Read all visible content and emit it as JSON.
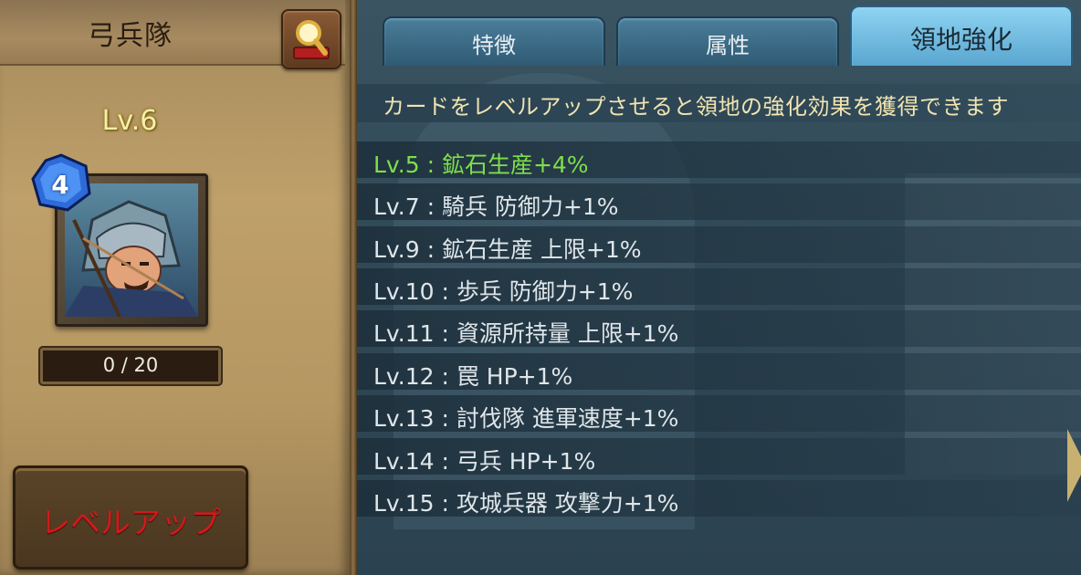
{
  "card": {
    "name": "弓兵隊",
    "level": "Lv.6",
    "stars": "4",
    "exp": "0 / 20",
    "levelup_label": "レベルアップ"
  },
  "tabs": [
    {
      "label": "特徴",
      "active": false
    },
    {
      "label": "属性",
      "active": false
    },
    {
      "label": "領地強化",
      "active": true
    }
  ],
  "info_text": "カードをレベルアップさせると領地の強化効果を獲得できます",
  "bonuses": [
    {
      "text": "Lv.5 : 鉱石生産+4%",
      "achieved": true
    },
    {
      "text": "Lv.7 : 騎兵 防御力+1%",
      "achieved": false
    },
    {
      "text": "Lv.9 : 鉱石生産 上限+1%",
      "achieved": false
    },
    {
      "text": "Lv.10 : 歩兵 防御力+1%",
      "achieved": false
    },
    {
      "text": "Lv.11 : 資源所持量 上限+1%",
      "achieved": false
    },
    {
      "text": "Lv.12 : 罠 HP+1%",
      "achieved": false
    },
    {
      "text": "Lv.13 : 討伐隊 進軍速度+1%",
      "achieved": false
    },
    {
      "text": "Lv.14 : 弓兵 HP+1%",
      "achieved": false
    },
    {
      "text": "Lv.15 : 攻城兵器 攻撃力+1%",
      "achieved": false
    }
  ],
  "colors": {
    "achieved": "#7ee04a",
    "normal": "#dfe6ea",
    "info": "#f1e4b0",
    "levelup": "#d11a1a"
  },
  "icons": {
    "search": "magnifier-icon",
    "badge": "star-gem-icon"
  }
}
